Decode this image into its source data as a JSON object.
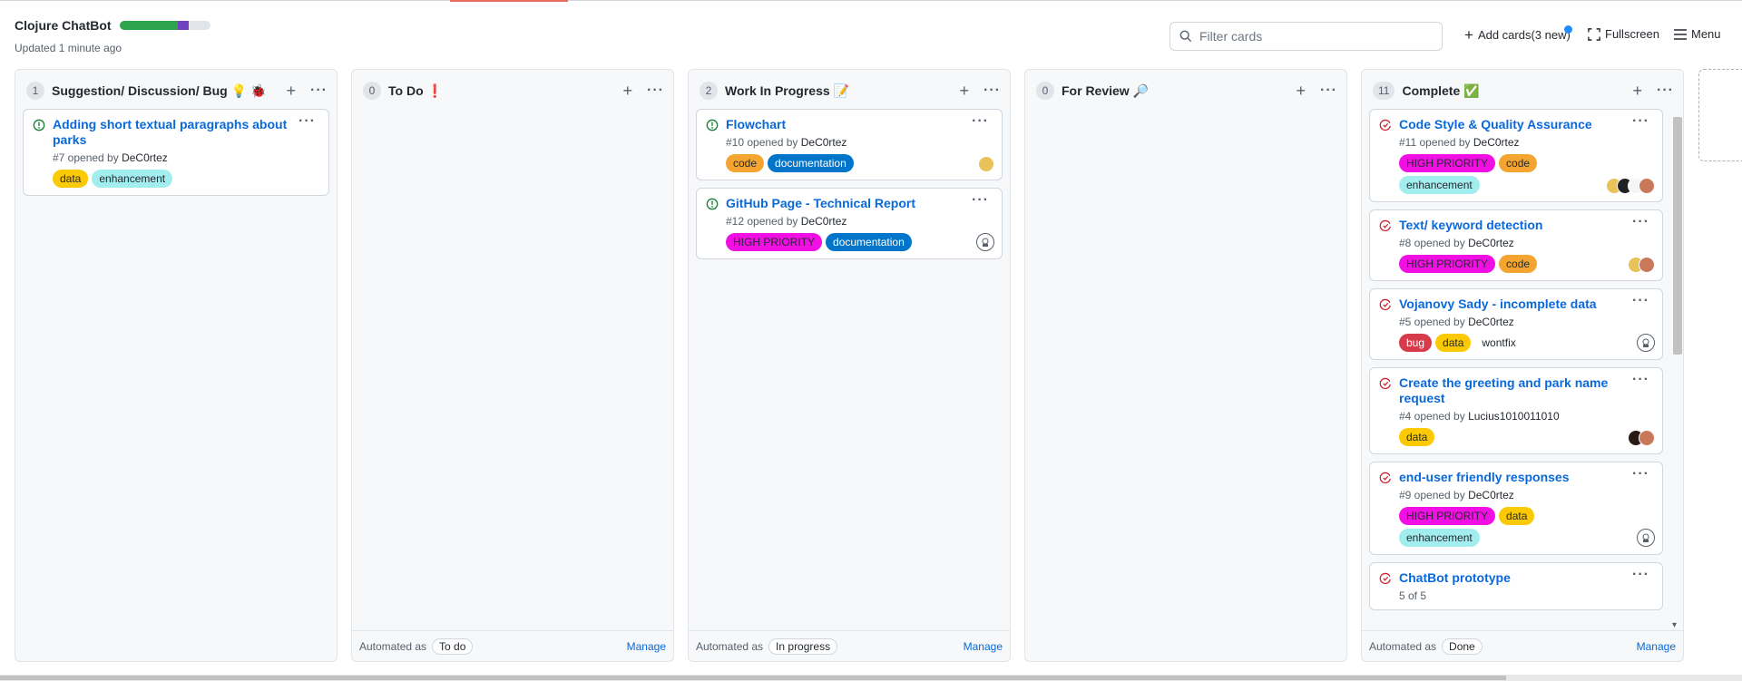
{
  "header": {
    "title": "Clojure ChatBot",
    "updated": "Updated 1 minute ago",
    "progress": {
      "done_fraction": 0.64,
      "in_progress_fraction": 0.12
    },
    "filter_placeholder": "Filter cards",
    "add_cards": "Add cards(3 new)",
    "fullscreen": "Fullscreen",
    "menu": "Menu"
  },
  "colors": {
    "open": "#1a7f37",
    "closed": "#cf222e",
    "link": "#0969da"
  },
  "columns": [
    {
      "count": "1",
      "name": "Suggestion/ Discussion/ Bug",
      "emoji": "💡 🐞",
      "cards": [
        {
          "title": "Adding short textual paragraphs about parks",
          "meta": "#7 opened by",
          "author": "DeC0rtez",
          "labels": [
            "data",
            "enhancement"
          ]
        }
      ]
    },
    {
      "count": "0",
      "name": "To Do",
      "emoji": "❗",
      "automated": "Automated as",
      "pill": "To do",
      "manage": "Manage"
    },
    {
      "count": "2",
      "name": "Work In Progress",
      "emoji": "📝",
      "automated": "Automated as",
      "pill": "In progress",
      "manage": "Manage",
      "cards": [
        {
          "title": "Flowchart",
          "meta": "#10 opened by",
          "author": "DeC0rtez",
          "labels": [
            "code",
            "documentation"
          ]
        },
        {
          "title": "GitHub Page - Technical Report",
          "meta": "#12 opened by",
          "author": "DeC0rtez",
          "labels": [
            "HIGH PRIORITY",
            "documentation"
          ]
        }
      ]
    },
    {
      "count": "0",
      "name": "For Review",
      "emoji": "🔎"
    },
    {
      "count": "11",
      "name": "Complete",
      "emoji": "✅",
      "automated": "Automated as",
      "pill": "Done",
      "manage": "Manage",
      "cards": [
        {
          "title": "Code Style & Quality Assurance",
          "meta": "#11 opened by",
          "author": "DeC0rtez",
          "labels": [
            "HIGH PRIORITY",
            "code",
            "enhancement"
          ]
        },
        {
          "title": "Text/ keyword detection",
          "meta": "#8 opened by",
          "author": "DeC0rtez",
          "labels": [
            "HIGH PRIORITY",
            "code"
          ]
        },
        {
          "title": "Vojanovy Sady - incomplete data",
          "meta": "#5 opened by",
          "author": "DeC0rtez",
          "labels": [
            "bug",
            "data"
          ],
          "plain_label": "wontfix"
        },
        {
          "title": "Create the greeting and park name request",
          "meta": "#4 opened by",
          "author": "Lucius1010011010",
          "labels": [
            "data"
          ]
        },
        {
          "title": "end-user friendly responses",
          "meta": "#9 opened by",
          "author": "DeC0rtez",
          "labels": [
            "HIGH PRIORITY",
            "data",
            "enhancement"
          ]
        },
        {
          "title": "ChatBot prototype",
          "meta": "5 of 5"
        }
      ]
    }
  ],
  "label_colors": {
    "data": {
      "bg": "#fbca04",
      "fg": "#24292f"
    },
    "enhancement": {
      "bg": "#a2eeef",
      "fg": "#24292f"
    },
    "code": {
      "bg": "#f4a531",
      "fg": "#24292f"
    },
    "documentation": {
      "bg": "#0075ca",
      "fg": "#ffffff"
    },
    "HIGH PRIORITY": {
      "bg": "#f20fe3",
      "fg": "#24292f"
    },
    "bug": {
      "bg": "#d73a4a",
      "fg": "#ffffff"
    }
  }
}
